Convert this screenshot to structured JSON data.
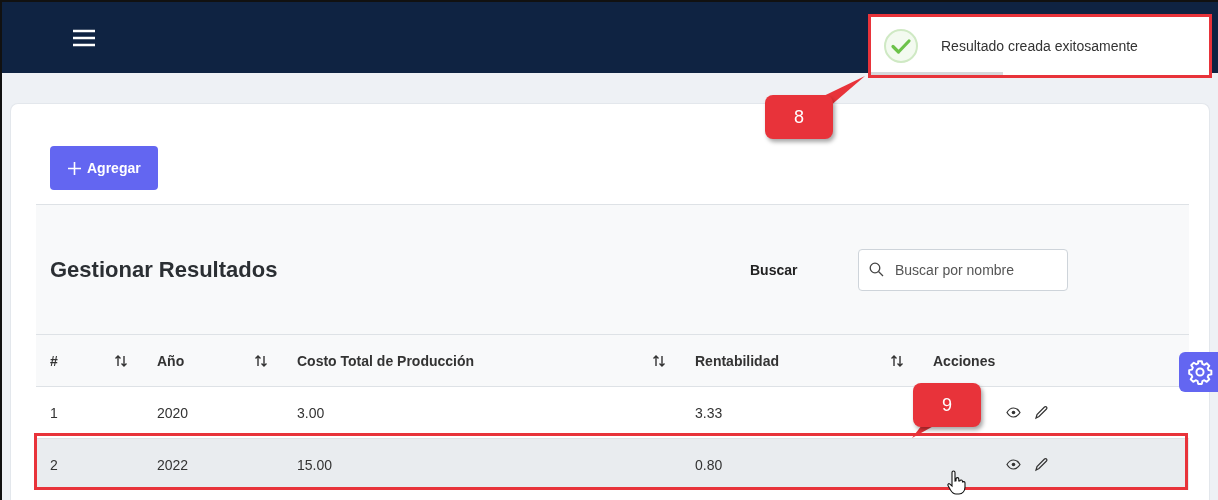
{
  "toast": {
    "message": "Resultado creada exitosamente",
    "level": 0.39
  },
  "toolbar": {
    "add_button": "Agregar"
  },
  "panel": {
    "title": "Gestionar Resultados",
    "search_label": "Buscar",
    "search": {
      "placeholder": "Buscar por nombre"
    }
  },
  "table": {
    "columns": [
      {
        "label": "#",
        "sortable": true
      },
      {
        "label": "Año",
        "sortable": true
      },
      {
        "label": "Costo Total de Producción",
        "sortable": true
      },
      {
        "label": "Rentabilidad",
        "sortable": true
      },
      {
        "label": "Acciones",
        "sortable": false
      }
    ],
    "rows": [
      {
        "cells": [
          "1",
          "2020",
          "3.00",
          "3.33"
        ],
        "selected": false
      },
      {
        "cells": [
          "2",
          "2022",
          "15.00",
          "0.80"
        ],
        "selected": true
      }
    ]
  },
  "callouts": [
    {
      "label": "8",
      "kind": "toast"
    },
    {
      "label": "9",
      "kind": "row"
    }
  ]
}
